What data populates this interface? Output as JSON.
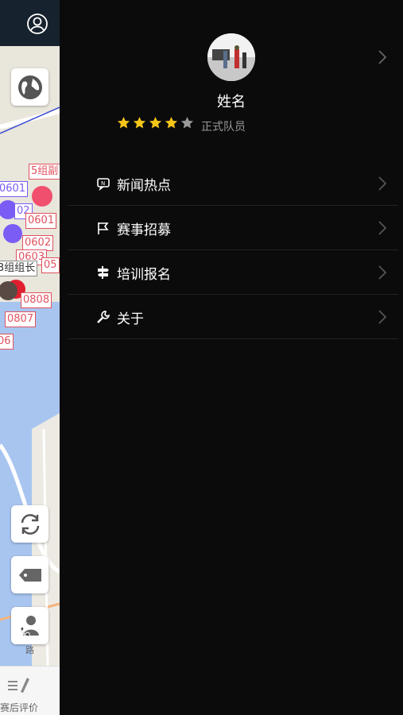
{
  "map": {
    "labels": [
      "5组副",
      "0601",
      "02",
      "0601",
      "0602",
      "0603",
      "05",
      "3组组长",
      "0808",
      "0807",
      "06"
    ],
    "road_label": "路",
    "bottom_tab_label": "赛后评价"
  },
  "profile": {
    "name": "姓名",
    "rating": 4,
    "rating_max": 5,
    "rank": "正式队员"
  },
  "menu": [
    {
      "label": "新闻热点",
      "icon": "news-icon"
    },
    {
      "label": "赛事招募",
      "icon": "flag-icon"
    },
    {
      "label": "培训报名",
      "icon": "signpost-icon"
    },
    {
      "label": "关于",
      "icon": "wrench-icon"
    }
  ],
  "colors": {
    "drawer_bg": "#0b0b0b",
    "star": "#f5c518",
    "star_empty": "#9a9a9a",
    "tag_red": "#e0525f",
    "marker_purple": "#7b5cf5",
    "marker_pink": "#f0506e",
    "marker_brown": "#5a4a44"
  }
}
